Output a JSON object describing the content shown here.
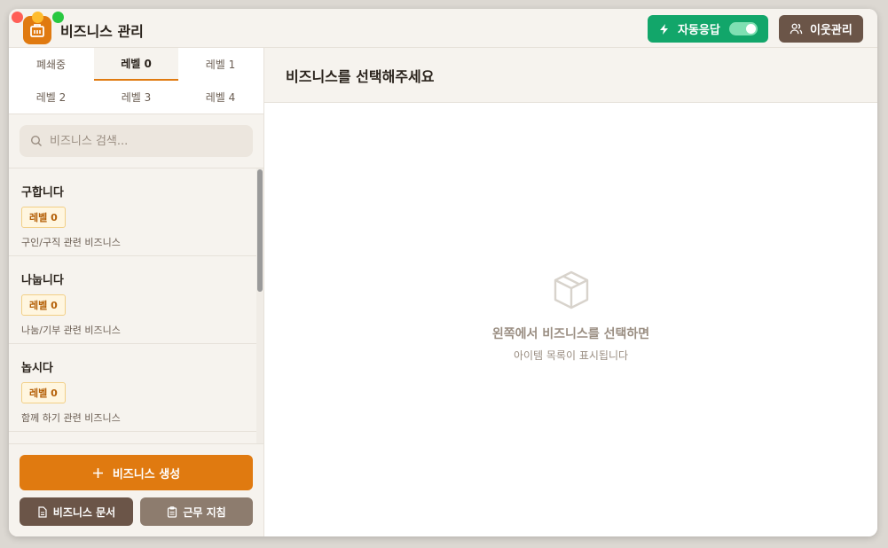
{
  "app": {
    "title": "비즈니스 관리"
  },
  "header": {
    "auto_reply_label": "자동응답",
    "auto_reply_enabled": true,
    "neighbor_label": "이웃관리"
  },
  "sidebar": {
    "tabs": [
      {
        "label": "폐쇄중",
        "active": false
      },
      {
        "label": "레벨 0",
        "active": true
      },
      {
        "label": "레벨 1",
        "active": false
      },
      {
        "label": "레벨 2",
        "active": false
      },
      {
        "label": "레벨 3",
        "active": false
      },
      {
        "label": "레벨 4",
        "active": false
      }
    ],
    "search": {
      "placeholder": "비즈니스 검색...",
      "value": ""
    },
    "items": [
      {
        "title": "구합니다",
        "badge": "레벨 0",
        "desc": "구인/구직 관련 비즈니스"
      },
      {
        "title": "나눕니다",
        "badge": "레벨 0",
        "desc": "나눔/기부 관련 비즈니스"
      },
      {
        "title": "놉시다",
        "badge": "레벨 0",
        "desc": "함께 하기 관련 비즈니스"
      }
    ],
    "footer": {
      "create_label": "비즈니스 생성",
      "doc_label": "비즈니스 문서",
      "rules_label": "근무 지침"
    }
  },
  "main": {
    "title": "비즈니스를 선택해주세요",
    "empty_title": "왼쪽에서 비즈니스를 선택하면",
    "empty_sub": "아이템 목록이 표시됩니다"
  },
  "colors": {
    "accent": "#e07a10",
    "success": "#12a66a",
    "brown": "#6b5548",
    "badge_text": "#b45f06"
  }
}
